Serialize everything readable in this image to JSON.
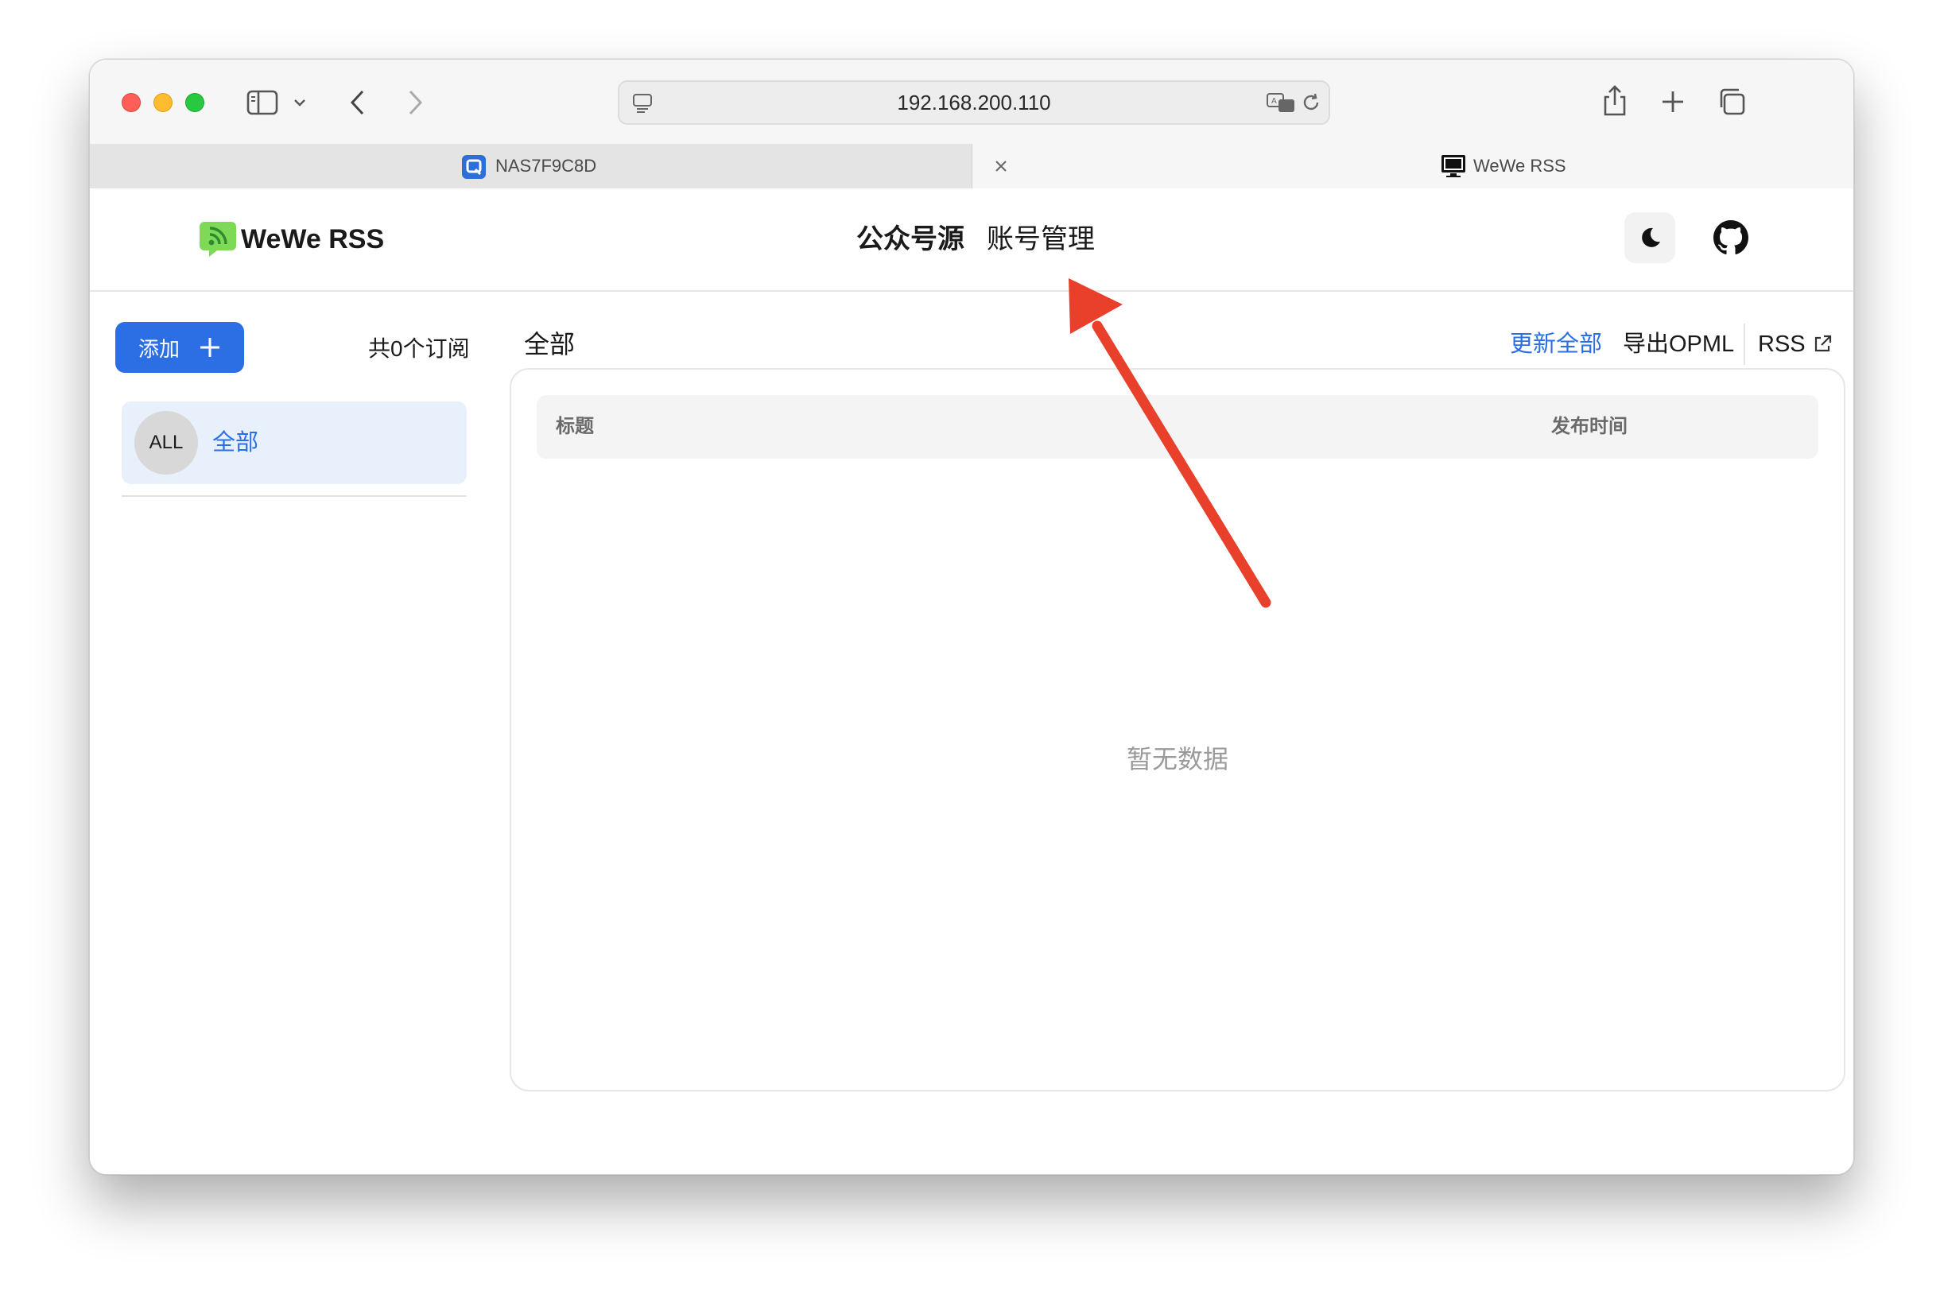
{
  "browser": {
    "address": "192.168.200.110",
    "tabs": [
      {
        "label": "NAS7F9C8D"
      },
      {
        "label": "WeWe RSS"
      }
    ]
  },
  "app": {
    "brand": "WeWe RSS",
    "nav": [
      "公众号源",
      "账号管理"
    ],
    "sidebar": {
      "add_label": "添加",
      "subscription_count": "共0个订阅",
      "feeds": [
        {
          "avatar": "ALL",
          "label": "全部"
        }
      ]
    },
    "main": {
      "title": "全部",
      "actions": {
        "refresh_all": "更新全部",
        "export_opml": "导出OPML",
        "rss": "RSS"
      },
      "table": {
        "columns": [
          "标题",
          "发布时间"
        ],
        "empty_text": "暂无数据"
      }
    }
  },
  "colors": {
    "accent": "#2c6fe5",
    "annotation_arrow": "#e8402b",
    "logo_green": "#7ed957"
  }
}
